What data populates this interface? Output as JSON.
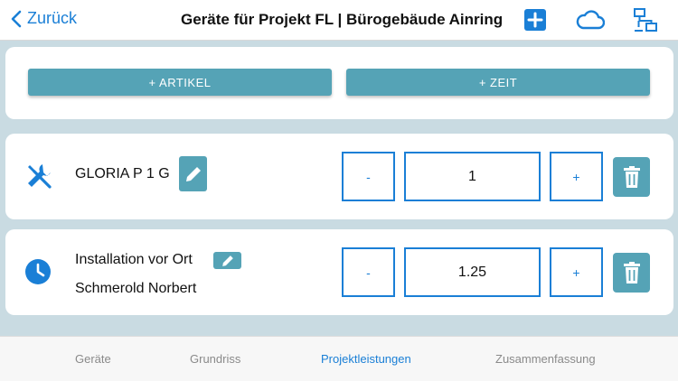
{
  "navbar": {
    "back_label": "Zurück",
    "title": "Geräte für Projekt FL | Bürogebäude Ainring",
    "icons": [
      "plus-square-icon",
      "cloud-icon",
      "network-icon"
    ]
  },
  "actions": {
    "add_article_label": "+ ARTIKEL",
    "add_time_label": "+ ZEIT"
  },
  "items": [
    {
      "icon": "tools-icon",
      "name": "GLORIA P 1 G",
      "sub": "",
      "decrement_label": "-",
      "quantity": "1",
      "increment_label": "+"
    },
    {
      "icon": "clock-icon",
      "name": "Installation vor Ort",
      "sub": "Schmerold Norbert",
      "decrement_label": "-",
      "quantity": "1.25",
      "increment_label": "+"
    }
  ],
  "tabs": [
    {
      "label": "Geräte",
      "active": false
    },
    {
      "label": "Grundriss",
      "active": false
    },
    {
      "label": "Projektleistungen",
      "active": true
    },
    {
      "label": "Zusammenfassung",
      "active": false
    }
  ],
  "colors": {
    "accent": "#1a7fd6",
    "button_teal": "#55a3b6",
    "background": "#c9dbe2"
  }
}
